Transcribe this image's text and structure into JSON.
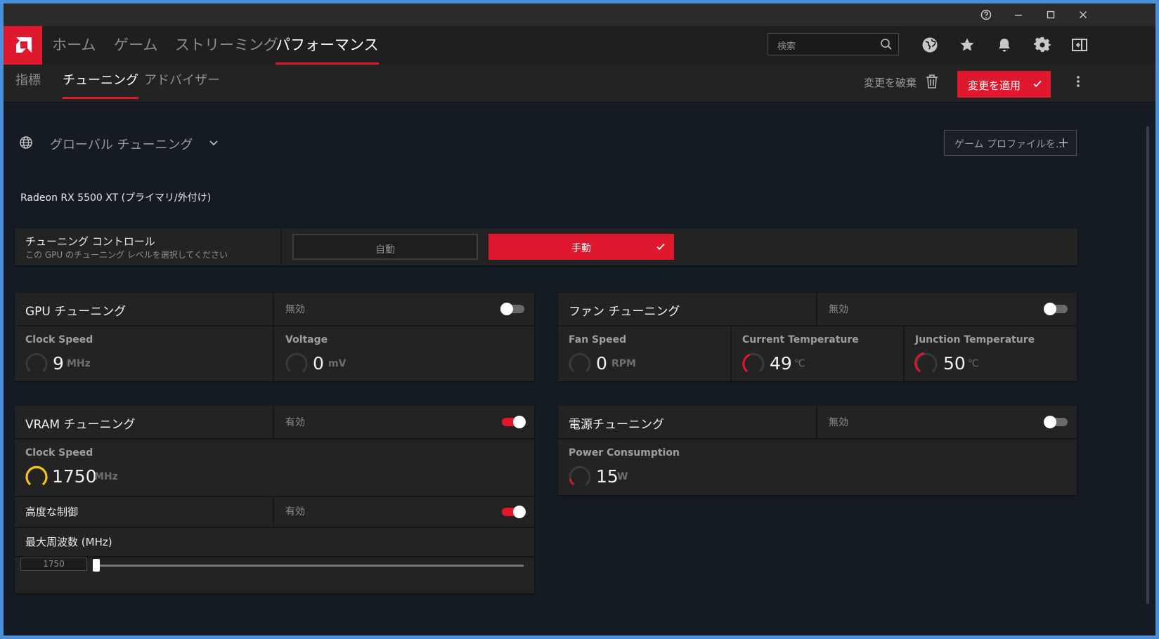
{
  "window": {
    "controls": [
      "help",
      "minimize",
      "maximize",
      "close"
    ]
  },
  "topnav": {
    "items": [
      {
        "label": "ホーム",
        "active": false
      },
      {
        "label": "ゲーム",
        "active": false
      },
      {
        "label": "ストリーミング",
        "active": false
      },
      {
        "label": "パフォーマンス",
        "active": true
      }
    ],
    "search_placeholder": "検索",
    "icons": [
      "globe-icon",
      "star-icon",
      "bell-icon",
      "gear-icon",
      "sidebar-icon"
    ]
  },
  "subnav": {
    "items": [
      {
        "label": "指標",
        "active": false
      },
      {
        "label": "チューニング",
        "active": true
      },
      {
        "label": "アドバイザー",
        "active": false
      }
    ],
    "discard_label": "変更を破棄",
    "apply_label": "変更を適用"
  },
  "profile": {
    "name": "グローバル チューニング",
    "game_profile_button": "ゲーム プロファイルを..."
  },
  "gpu_name": "Radeon RX 5500 XT (プライマリ/外付け)",
  "tuning_control": {
    "title": "チューニング コントロール",
    "subtitle": "この GPU のチューニング レベルを選択してください",
    "auto_label": "自動",
    "manual_label": "手動",
    "selected": "手動"
  },
  "gpu_tuning": {
    "title": "GPU チューニング",
    "status": "無効",
    "enabled": false,
    "clock": {
      "label": "Clock Speed",
      "value": "9",
      "unit": "MHz"
    },
    "voltage": {
      "label": "Voltage",
      "value": "0",
      "unit": "mV"
    }
  },
  "fan_tuning": {
    "title": "ファン チューニング",
    "status": "無効",
    "enabled": false,
    "fan_speed": {
      "label": "Fan Speed",
      "value": "0",
      "unit": "RPM"
    },
    "current_temp": {
      "label": "Current Temperature",
      "value": "49",
      "unit": "℃"
    },
    "junction_temp": {
      "label": "Junction Temperature",
      "value": "50",
      "unit": "℃"
    }
  },
  "vram_tuning": {
    "title": "VRAM チューニング",
    "status": "有効",
    "enabled": true,
    "clock": {
      "label": "Clock Speed",
      "value": "1750",
      "unit": "MHz"
    },
    "advanced": {
      "label": "高度な制御",
      "status": "有効",
      "enabled": true
    },
    "max_freq": {
      "label": "最大周波数 (MHz)",
      "value": "1750"
    }
  },
  "power_tuning": {
    "title": "電源チューニング",
    "status": "無効",
    "enabled": false,
    "power": {
      "label": "Power Consumption",
      "value": "15",
      "unit": "W"
    }
  },
  "colors": {
    "accent": "#e0182d",
    "gauge_idle": "#3a3a3a",
    "gauge_vram": "#f5c518"
  }
}
